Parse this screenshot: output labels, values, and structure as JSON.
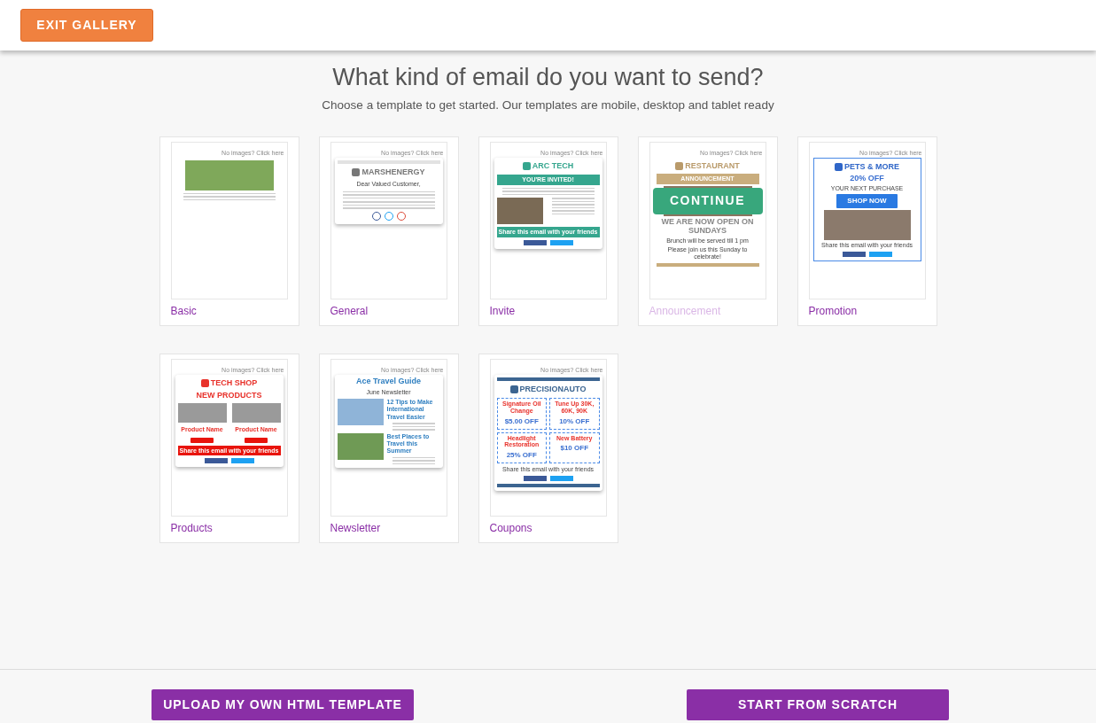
{
  "header": {
    "exit_button": "EXIT GALLERY"
  },
  "heading": "What kind of email do you want to send?",
  "subheading": "Choose a template to get started. Our templates are mobile, desktop and tablet ready",
  "overlay_button": "CONTINUE",
  "templates": [
    {
      "name": "Basic",
      "hovered": false,
      "kind": "plain",
      "top_note": "No images? Click here",
      "blocks": [
        {
          "kind": "image",
          "color": "#7fa85a"
        },
        {
          "kind": "lines"
        }
      ]
    },
    {
      "name": "General",
      "hovered": false,
      "kind": "card",
      "top_note": "No images? Click here",
      "blocks": [
        {
          "kind": "rule",
          "color": "#e2e2e2"
        },
        {
          "kind": "logo",
          "text": "MARSHENERGY",
          "color": "#777777"
        },
        {
          "kind": "text",
          "text": "Dear Valued Customer,"
        },
        {
          "kind": "lines"
        },
        {
          "kind": "lines"
        },
        {
          "kind": "social_round"
        }
      ]
    },
    {
      "name": "Invite",
      "hovered": false,
      "kind": "card",
      "top_note": "No images? Click here",
      "blocks": [
        {
          "kind": "logo",
          "text": "ARC TECH",
          "color": "#35a68e"
        },
        {
          "kind": "banner",
          "text": "YOU'RE INVITED!",
          "color": "#35a68e"
        },
        {
          "kind": "lines"
        },
        {
          "kind": "article",
          "color": "#7a6a55"
        },
        {
          "kind": "banner",
          "text": "Share this email with your friends",
          "color": "#35a68e"
        },
        {
          "kind": "social_buttons"
        }
      ]
    },
    {
      "name": "Announcement",
      "hovered": true,
      "kind": "plain",
      "top_note": "No images? Click here",
      "blocks": [
        {
          "kind": "logo",
          "text": "RESTAURANT",
          "color": "#b99a6a"
        },
        {
          "kind": "banner",
          "text": "ANNOUNCEMENT",
          "color": "#c9ad7d"
        },
        {
          "kind": "image",
          "color": "#8a7560"
        },
        {
          "kind": "heading",
          "text": "WE ARE NOW OPEN ON SUNDAYS",
          "color": "#888888"
        },
        {
          "kind": "text",
          "text": "Brunch will be served till 1 pm"
        },
        {
          "kind": "text",
          "text": "Please join us this Sunday to celebrate!"
        },
        {
          "kind": "rule",
          "color": "#c9ad7d"
        }
      ]
    },
    {
      "name": "Promotion",
      "hovered": false,
      "kind": "outlined",
      "top_note": "No images? Click here",
      "blocks": [
        {
          "kind": "logo",
          "text": "PETS & MORE",
          "color": "#2f66c8"
        },
        {
          "kind": "heading",
          "text": "20% OFF",
          "color": "#3a6fd0"
        },
        {
          "kind": "text",
          "text": "YOUR NEXT PURCHASE"
        },
        {
          "kind": "button",
          "text": "SHOP NOW",
          "color": "#2a7ae2"
        },
        {
          "kind": "image",
          "color": "#8b7a6c"
        },
        {
          "kind": "text",
          "text": "Share this email with your friends"
        },
        {
          "kind": "social_buttons"
        }
      ]
    },
    {
      "name": "Products",
      "hovered": false,
      "kind": "card",
      "top_note": "No images? Click here",
      "blocks": [
        {
          "kind": "logo",
          "text": "TECH SHOP",
          "color": "#e8322b"
        },
        {
          "kind": "heading",
          "text": "NEW PRODUCTS",
          "color": "#e8322b"
        },
        {
          "kind": "pair",
          "items": [
            {
              "title": "Product Name"
            },
            {
              "title": "Product Name"
            }
          ]
        },
        {
          "kind": "banner",
          "text": "Share this email with your friends",
          "color": "#e8140c"
        },
        {
          "kind": "social_buttons"
        }
      ]
    },
    {
      "name": "Newsletter",
      "hovered": false,
      "kind": "card",
      "top_note": "No images? Click here",
      "blocks": [
        {
          "kind": "heading",
          "text": "Ace Travel Guide",
          "color": "#2f7fc0"
        },
        {
          "kind": "text",
          "text": "June Newsletter"
        },
        {
          "kind": "article",
          "color": "#8fb4d8",
          "title": "12 Tips to Make International Travel Easier"
        },
        {
          "kind": "article",
          "color": "#6f9a55",
          "title": "Best Places to Travel this Summer"
        }
      ]
    },
    {
      "name": "Coupons",
      "hovered": false,
      "kind": "card",
      "top_note": "No images? Click here",
      "blocks": [
        {
          "kind": "rule",
          "color": "#3c6591"
        },
        {
          "kind": "logo",
          "text": "PRECISIONAUTO",
          "color": "#3c6591"
        },
        {
          "kind": "coupons",
          "items": [
            {
              "title": "Signature Oil Change",
              "offer": "$5.00 OFF"
            },
            {
              "title": "Tune Up 30K, 60K, 90K",
              "offer": "10% OFF"
            },
            {
              "title": "Headlight Restoration",
              "offer": "25% OFF"
            },
            {
              "title": "New Battery",
              "offer": "$10 OFF"
            }
          ]
        },
        {
          "kind": "text",
          "text": "Share this email with your friends"
        },
        {
          "kind": "social_buttons"
        },
        {
          "kind": "rule",
          "color": "#3c6591"
        }
      ]
    }
  ],
  "footer": {
    "buttons": [
      "UPLOAD MY OWN HTML TEMPLATE",
      "START FROM SCRATCH"
    ]
  }
}
